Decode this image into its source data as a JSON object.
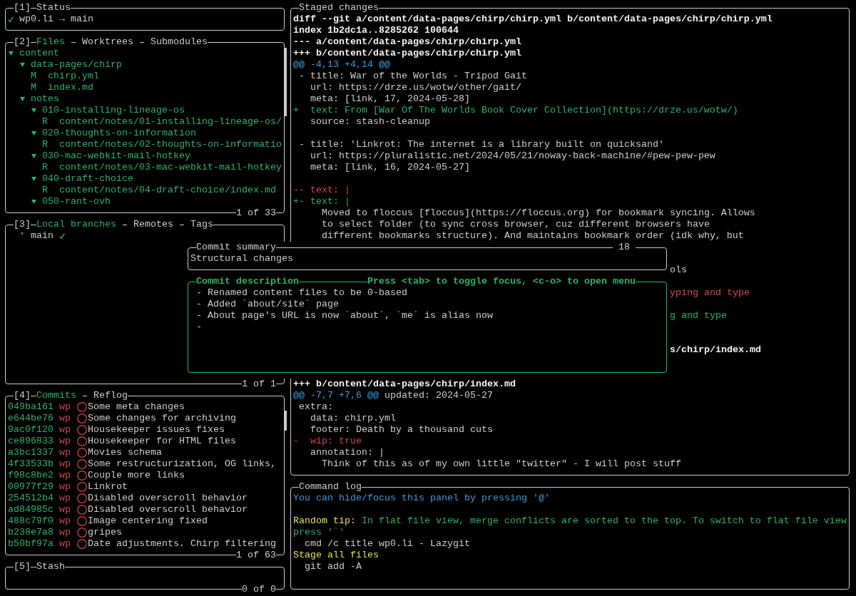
{
  "status": {
    "number": "[1]",
    "title": "Status",
    "synced": true,
    "text": "wp0.li → main"
  },
  "files": {
    "number": "[2]",
    "tabs": [
      {
        "label": "Files",
        "selected": true
      },
      {
        "label": "Worktrees",
        "selected": false
      },
      {
        "label": "Submodules",
        "selected": false
      }
    ],
    "tree": [
      {
        "kind": "folder",
        "name": "content",
        "expanded": true,
        "children": [
          {
            "kind": "folder",
            "name": "data-pages/chirp",
            "expanded": true,
            "children": [
              {
                "kind": "file",
                "status": "M",
                "name": "chirp.yml"
              },
              {
                "kind": "file",
                "status": "M",
                "name": "index.md"
              }
            ]
          },
          {
            "kind": "folder",
            "name": "notes",
            "expanded": true,
            "children": [
              {
                "kind": "folder",
                "name": "010-installing-lineage-os",
                "expanded": true,
                "children": [
                  {
                    "kind": "file",
                    "status": "R",
                    "name": "content/notes/01-installing-lineage-os/"
                  }
                ]
              },
              {
                "kind": "folder",
                "name": "020-thoughts-on-information",
                "expanded": true,
                "children": [
                  {
                    "kind": "file",
                    "status": "R",
                    "name": "content/notes/02-thoughts-on-informatio"
                  }
                ]
              },
              {
                "kind": "folder",
                "name": "030-mac-webkit-mail-hotkey",
                "expanded": true,
                "children": [
                  {
                    "kind": "file",
                    "status": "R",
                    "name": "content/notes/03-mac-webkit-mail-hotkey"
                  }
                ]
              },
              {
                "kind": "folder",
                "name": "040-draft-choice",
                "expanded": true,
                "children": [
                  {
                    "kind": "file",
                    "status": "R",
                    "name": "content/notes/04-draft-choice/index.md"
                  }
                ]
              },
              {
                "kind": "folder",
                "name": "050-rant-ovh",
                "expanded": true
              }
            ]
          }
        ]
      }
    ],
    "counter": "1 of 33"
  },
  "branches": {
    "number": "[3]",
    "tabs": [
      {
        "label": "Local branches",
        "selected": true
      },
      {
        "label": "Remotes",
        "selected": false
      },
      {
        "label": "Tags",
        "selected": false
      }
    ],
    "items": [
      {
        "marker": "*",
        "name": "main",
        "synced": true
      }
    ],
    "counter": "1 of 1"
  },
  "commits": {
    "number": "[4]",
    "tabs": [
      {
        "label": "Commits",
        "selected": true
      },
      {
        "label": "Reflog",
        "selected": false
      }
    ],
    "items": [
      {
        "hash": "049ba161",
        "author": "wp",
        "message": "Some meta changes"
      },
      {
        "hash": "e644be76",
        "author": "wp",
        "message": "Some changes for archiving"
      },
      {
        "hash": "9ac0f120",
        "author": "wp",
        "message": "Housekeeper issues fixes"
      },
      {
        "hash": "ce896833",
        "author": "wp",
        "message": "Housekeeper for HTML files"
      },
      {
        "hash": "a3bc1337",
        "author": "wp",
        "message": "Movies schema"
      },
      {
        "hash": "4f33533b",
        "author": "wp",
        "message": "Some restructurization, OG links,"
      },
      {
        "hash": "f98c8be2",
        "author": "wp",
        "message": "Couple more links"
      },
      {
        "hash": "00977f29",
        "author": "wp",
        "message": "Linkrot"
      },
      {
        "hash": "254512b4",
        "author": "wp",
        "message": "Disabled overscroll behavior"
      },
      {
        "hash": "ad84985c",
        "author": "wp",
        "message": "Disabled overscroll behavior"
      },
      {
        "hash": "488c79f0",
        "author": "wp",
        "message": "Image centering fixed"
      },
      {
        "hash": "b238e7a8",
        "author": "wp",
        "message": "gripes"
      },
      {
        "hash": "b50bf97a",
        "author": "wp",
        "message": "Date adjustments. Chirp filtering"
      }
    ],
    "counter": "1 of 63"
  },
  "stash": {
    "number": "[5]",
    "title": "Stash",
    "counter": "0 of 0"
  },
  "staged_changes": {
    "title": "Staged changes",
    "lines": [
      {
        "kind": "header",
        "text": "diff --git a/content/data-pages/chirp/chirp.yml b/content/data-pages/chirp/chirp.yml"
      },
      {
        "kind": "header",
        "text": "index 1b2dc1a..8285262 100644"
      },
      {
        "kind": "header",
        "text": "--- a/content/data-pages/chirp/chirp.yml"
      },
      {
        "kind": "header",
        "text": "+++ b/content/data-pages/chirp/chirp.yml"
      },
      {
        "kind": "hunk",
        "range": "@@ -4,13 +4,14 @@"
      },
      {
        "kind": "context",
        "text": " - title: War of the Worlds - Tripod Gait"
      },
      {
        "kind": "context",
        "text": "   url: https://drze.us/wotw/other/gait/"
      },
      {
        "kind": "context",
        "text": "   meta: [link, 17, 2024-05-28]"
      },
      {
        "kind": "added",
        "text": "+  text: From [War Of The Worlds Book Cover Collection](https://drze.us/wotw/)"
      },
      {
        "kind": "context",
        "text": "   source: stash-cleanup"
      },
      {
        "kind": "blank"
      },
      {
        "kind": "context",
        "text": " - title: 'Linkrot: The internet is a library built on quicksand'"
      },
      {
        "kind": "context",
        "text": "   url: https://pluralistic.net/2024/05/21/noway-back-machine/#pew-pew-pew"
      },
      {
        "kind": "context",
        "text": "   meta: [link, 16, 2024-05-27]"
      },
      {
        "kind": "blank"
      },
      {
        "kind": "removed",
        "text": "-- text: |"
      },
      {
        "kind": "added",
        "text": "+- text: |"
      },
      {
        "kind": "context",
        "text": "     Moved to floccus [floccus](https://floccus.org) for bookmark syncing. Allows"
      },
      {
        "kind": "context",
        "text": "     to select folder (to sync cross browser, cuz different browsers have"
      },
      {
        "kind": "context",
        "text": "     different bookmarks structure). And maintains bookmark order (idk why, but"
      },
      {
        "kind": "blank"
      },
      {
        "kind": "blank"
      },
      {
        "kind": "context",
        "text": "ols"
      },
      {
        "kind": "blank"
      },
      {
        "kind": "removed",
        "text": "yping and type"
      },
      {
        "kind": "blank"
      },
      {
        "kind": "added",
        "text": "g and type"
      },
      {
        "kind": "blank"
      },
      {
        "kind": "blank"
      },
      {
        "kind": "header",
        "text": "s/chirp/index.md"
      },
      {
        "kind": "blank"
      },
      {
        "kind": "blank"
      },
      {
        "kind": "header",
        "text": "+++ b/content/data-pages/chirp/index.md"
      },
      {
        "kind": "hunk",
        "range": "@@ -7,7 +7,6 @@",
        "text": "updated: 2024-05-27"
      },
      {
        "kind": "context",
        "text": " extra:"
      },
      {
        "kind": "context",
        "text": "   data: chirp.yml"
      },
      {
        "kind": "context",
        "text": "   footer: Death by a thousand cuts"
      },
      {
        "kind": "removed",
        "text": "-  wip: true"
      },
      {
        "kind": "context",
        "text": "   annotation: |"
      },
      {
        "kind": "context",
        "text": "     Think of this as of my own little \"twitter\" - I will post stuff"
      }
    ]
  },
  "command_log": {
    "title": "Command log",
    "lines": [
      {
        "kind": "info",
        "text": "You can hide/focus this panel by pressing '@'"
      },
      {
        "kind": "blank"
      },
      {
        "kind": "tip",
        "label": "Random tip:",
        "text": "In flat file view, merge conflicts are sorted to the top. To switch to flat file view press '`'"
      },
      {
        "kind": "command",
        "text": "  cmd /c title wp0.li - Lazygit"
      },
      {
        "kind": "action",
        "text": "Stage all files"
      },
      {
        "kind": "command",
        "text": "  git add -A"
      }
    ]
  },
  "commit_summary": {
    "title": "Commit summary",
    "counter": "18",
    "value": "Structural changes",
    "focused": false
  },
  "commit_description": {
    "title": "Commit description",
    "hint": "Press <tab> to toggle focus, <c-o> to open menu",
    "lines": [
      "- Renamed content files to be 0-based",
      "- Added `about/site` page",
      "- About page's URL is now `about`, `me` is alias now",
      "-"
    ],
    "focused": true
  }
}
